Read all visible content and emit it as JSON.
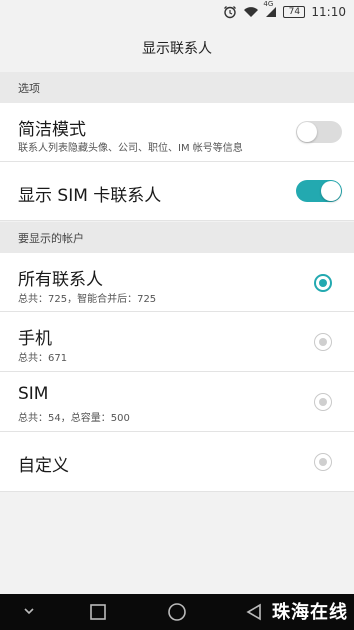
{
  "status_bar": {
    "time": "11:10",
    "network": "4G",
    "battery": "74",
    "icons": [
      "alarm-icon",
      "wifi-icon",
      "signal-icon",
      "battery-icon"
    ]
  },
  "app_bar": {
    "title": "显示联系人"
  },
  "sections": [
    {
      "header": "选项"
    },
    {
      "header": "要显示的帐户"
    }
  ],
  "options": {
    "simple_mode": {
      "title": "简洁模式",
      "subtitle": "联系人列表隐藏头像、公司、职位、IM 帐号等信息",
      "enabled": false
    },
    "show_sim": {
      "title": "显示 SIM 卡联系人",
      "enabled": true
    }
  },
  "accounts": [
    {
      "title": "所有联系人",
      "subtitle": "总共：725，智能合并后：725",
      "selected": true
    },
    {
      "title": "手机",
      "subtitle": "总共：671",
      "selected": false
    },
    {
      "title": "SIM",
      "subtitle": "总共：54，总容量：500",
      "selected": false
    },
    {
      "title": "自定义",
      "subtitle": "",
      "selected": false
    }
  ],
  "colors": {
    "accent": "#23a9b0",
    "background": "#f2f2f2",
    "section_header": "#e9e9e9",
    "nav_bar": "#0a0a0a"
  },
  "nav_bar": {
    "icons": [
      "chevron-down-icon",
      "square-icon",
      "circle-icon",
      "back-triangle-icon"
    ]
  },
  "watermark": "珠海在线"
}
